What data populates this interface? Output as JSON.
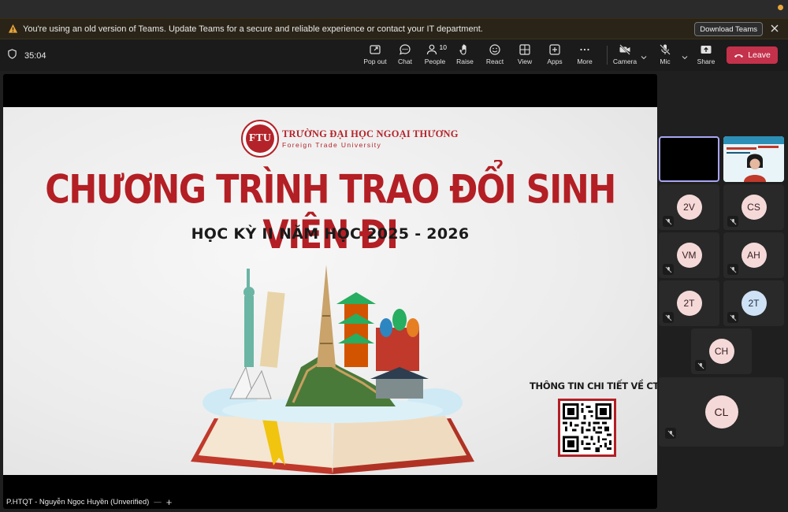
{
  "warning": {
    "message": "You're using an old version of Teams. Update Teams for a secure and reliable experience or contact your IT department.",
    "download_label": "Download Teams"
  },
  "meeting": {
    "timer": "35:04",
    "people_count": "10"
  },
  "toolbar": {
    "popout": "Pop out",
    "chat": "Chat",
    "people": "People",
    "raise": "Raise",
    "react": "React",
    "view": "View",
    "apps": "Apps",
    "more": "More",
    "camera": "Camera",
    "mic": "Mic",
    "share": "Share",
    "leave": "Leave"
  },
  "slide": {
    "logo_vi": "TRƯỜNG ĐẠI HỌC NGOẠI THƯƠNG",
    "logo_en": "Foreign Trade University",
    "logo_mark": "FTU",
    "title": "CHƯƠNG TRÌNH TRAO ĐỔI SINH VIÊN ĐI",
    "subtitle": "HỌC KỲ II NĂM HỌC 2025 - 2026",
    "qr_title": "THÔNG TIN CHI TIẾT VỀ CTTĐ"
  },
  "presenter": {
    "label": "P.HTQT - Nguyễn Ngọc Huyền (Unverified)"
  },
  "participants": [
    {
      "initials": "2V",
      "color": "pink"
    },
    {
      "initials": "CS",
      "color": "pink"
    },
    {
      "initials": "VM",
      "color": "pink"
    },
    {
      "initials": "AH",
      "color": "pink"
    },
    {
      "initials": "2T",
      "color": "pink"
    },
    {
      "initials": "2T",
      "color": "blue"
    },
    {
      "initials": "CH",
      "color": "pink"
    },
    {
      "initials": "CL",
      "color": "pink"
    }
  ],
  "colors": {
    "accent_red": "#b31f24",
    "leave_red": "#c4314b",
    "warning_orange": "#e8a43a",
    "self_border": "#a8a6f2"
  }
}
